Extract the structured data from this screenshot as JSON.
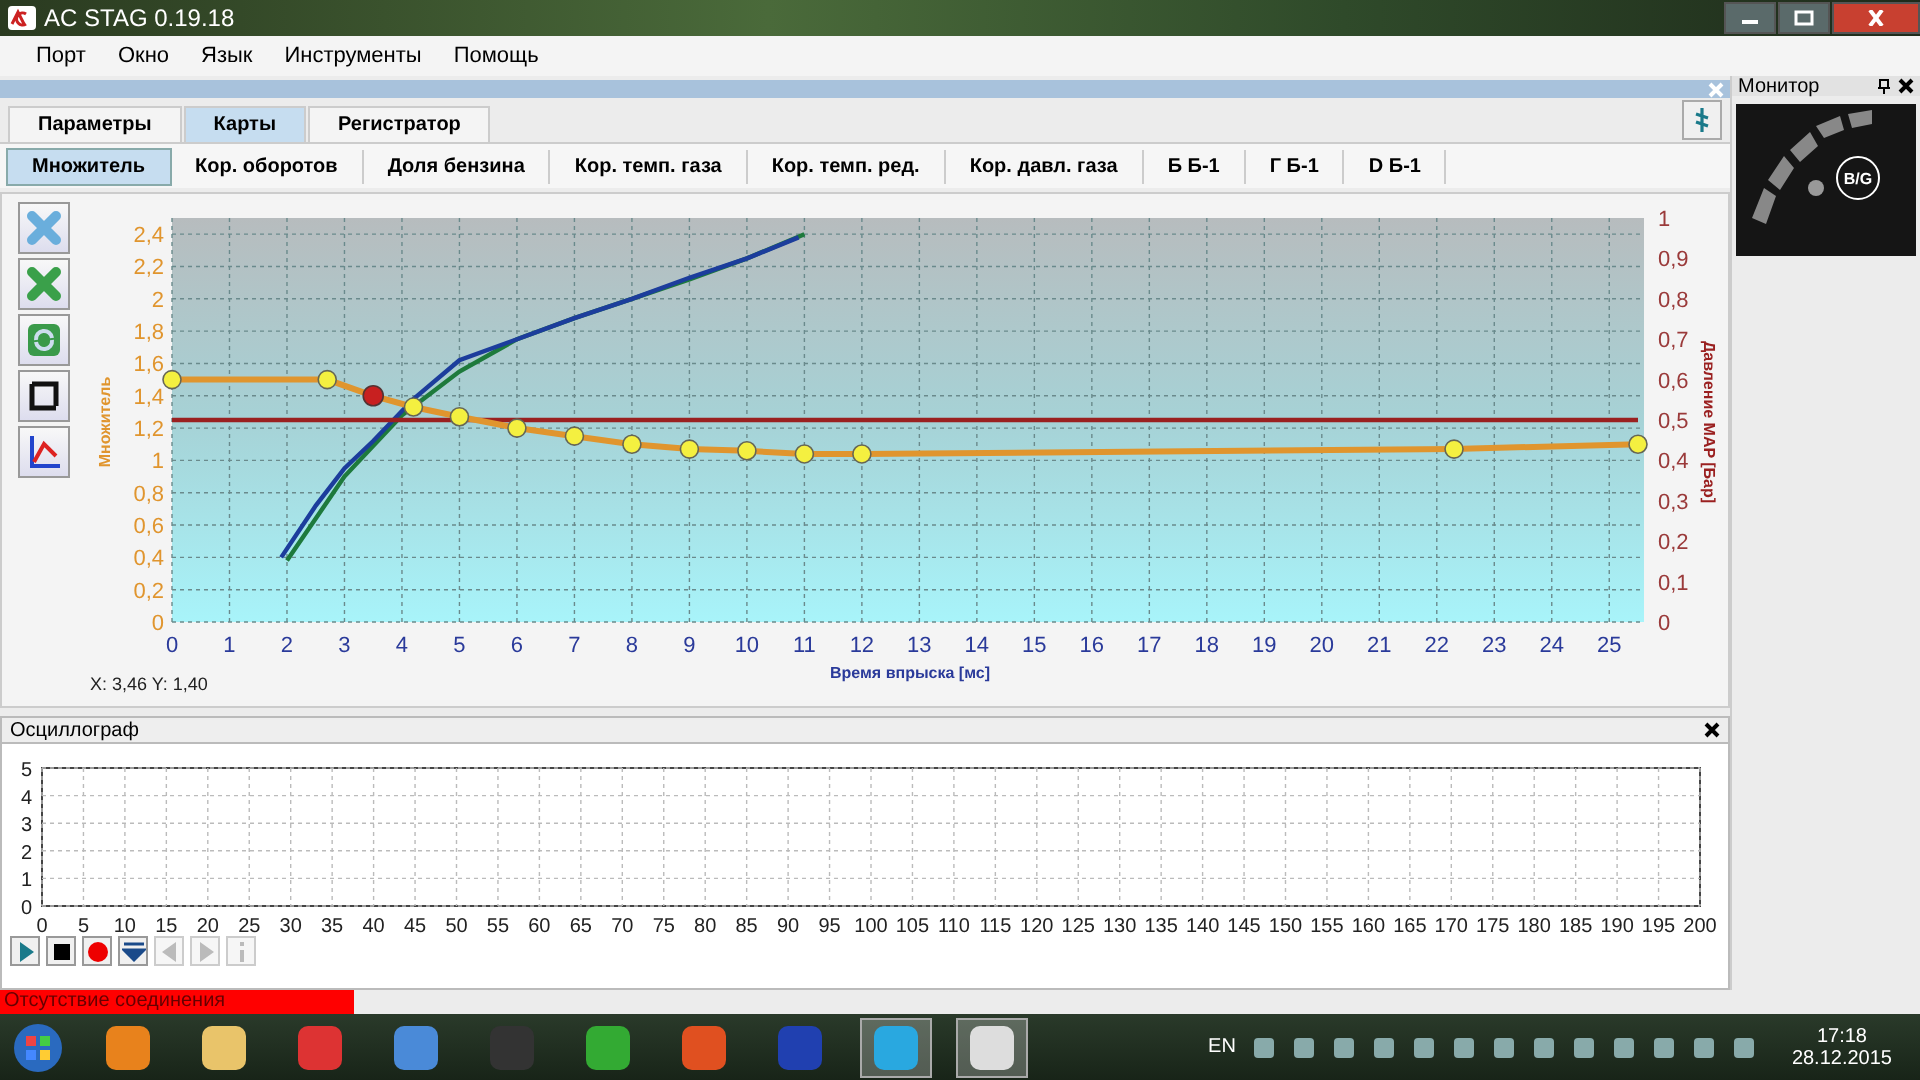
{
  "window": {
    "title": "AC STAG 0.19.18"
  },
  "menu": [
    "Порт",
    "Окно",
    "Язык",
    "Инструменты",
    "Помощь"
  ],
  "tabs": [
    {
      "label": "Параметры",
      "selected": false
    },
    {
      "label": "Карты",
      "selected": true
    },
    {
      "label": "Регистратор",
      "selected": false
    }
  ],
  "subtabs": [
    {
      "label": "Множитель",
      "selected": true
    },
    {
      "label": "Кор. оборотов",
      "selected": false
    },
    {
      "label": "Доля бензина",
      "selected": false
    },
    {
      "label": "Кор. темп. газа",
      "selected": false
    },
    {
      "label": "Кор. темп. ред.",
      "selected": false
    },
    {
      "label": "Кор. давл. газа",
      "selected": false
    },
    {
      "label": "Б Б-1",
      "selected": false
    },
    {
      "label": "Г Б-1",
      "selected": false
    },
    {
      "label": "D Б-1",
      "selected": false
    }
  ],
  "chart_tools": [
    {
      "kind": "clear-blue"
    },
    {
      "kind": "clear-green"
    },
    {
      "kind": "refresh"
    },
    {
      "kind": "frame"
    },
    {
      "kind": "curve"
    }
  ],
  "map_chart": {
    "chart_data": {
      "type": "line",
      "xlabel": "Время впрыска [мс]",
      "ylabel": "Множитель",
      "xlim": [
        0,
        25.5
      ],
      "ylim": [
        0,
        2.5
      ],
      "xticks": [
        0,
        1,
        2,
        3,
        4,
        5,
        6,
        7,
        8,
        9,
        10,
        11,
        12,
        13,
        14,
        15,
        16,
        17,
        18,
        19,
        20,
        21,
        22,
        23,
        24,
        25
      ],
      "yticks": [
        {
          "value": 0,
          "label": "0"
        },
        {
          "value": 0.2,
          "label": "0,2"
        },
        {
          "value": 0.4,
          "label": "0,4"
        },
        {
          "value": 0.6,
          "label": "0,6"
        },
        {
          "value": 0.8,
          "label": "0,8"
        },
        {
          "value": 1,
          "label": "1"
        },
        {
          "value": 1.2,
          "label": "1,2"
        },
        {
          "value": 1.4,
          "label": "1,4"
        },
        {
          "value": 1.6,
          "label": "1,6"
        },
        {
          "value": 1.8,
          "label": "1,8"
        },
        {
          "value": 2,
          "label": "2"
        },
        {
          "value": 2.2,
          "label": "2,2"
        },
        {
          "value": 2.4,
          "label": "2,4"
        }
      ],
      "grid": true,
      "series": [
        {
          "color": "#e0952e",
          "marker": "circle",
          "x": [
            0,
            2.7,
            3.5,
            4.2,
            5,
            6,
            7,
            8,
            9,
            10,
            11,
            12,
            22.3,
            25.5
          ],
          "values": [
            1.5,
            1.5,
            1.4,
            1.33,
            1.27,
            1.2,
            1.15,
            1.1,
            1.07,
            1.06,
            1.04,
            1.04,
            1.07,
            1.1
          ]
        },
        {
          "color": "#1e7a3c",
          "x": [
            2,
            3,
            4,
            5,
            6,
            7,
            8,
            9,
            10,
            11
          ],
          "values": [
            0.38,
            0.9,
            1.28,
            1.55,
            1.75,
            1.88,
            2.0,
            2.12,
            2.25,
            2.4
          ]
        },
        {
          "color": "#1c3d9c",
          "x": [
            1.9,
            2.5,
            3,
            3.5,
            4.2,
            5,
            6,
            7,
            8,
            9,
            10,
            10.9
          ],
          "values": [
            0.4,
            0.72,
            0.95,
            1.12,
            1.38,
            1.62,
            1.75,
            1.88,
            2.0,
            2.13,
            2.25,
            2.38
          ]
        },
        {
          "color": "#9a2020",
          "x": [
            0,
            25.5
          ],
          "values": [
            1.25,
            1.25
          ]
        }
      ]
    },
    "curve_points": [
      {
        "selected": false
      },
      {
        "selected": false
      },
      {
        "selected": true
      },
      {
        "selected": false
      },
      {
        "selected": false
      },
      {
        "selected": false
      },
      {
        "selected": false
      },
      {
        "selected": false
      },
      {
        "selected": false
      },
      {
        "selected": false
      },
      {
        "selected": false
      },
      {
        "selected": false
      },
      {
        "selected": false
      },
      {
        "selected": false
      }
    ],
    "right_axis": {
      "label": "Давление MAP [Бар]",
      "ticks": [
        "1",
        "0,9",
        "0,8",
        "0,7",
        "0,6",
        "0,5",
        "0,4",
        "0,3",
        "0,2",
        "0,1",
        "0"
      ]
    },
    "cursor": "X: 3,46  Y: 1,40"
  },
  "oscillograph": {
    "title": "Осциллограф",
    "chart_data": {
      "type": "line",
      "grid": true,
      "xlim": [
        0,
        200
      ],
      "ylim": [
        0,
        5
      ],
      "yticks": [
        0,
        1,
        2,
        3,
        4,
        5
      ],
      "xticks": [
        0,
        5,
        10,
        15,
        20,
        25,
        30,
        35,
        40,
        45,
        50,
        55,
        60,
        65,
        70,
        75,
        80,
        85,
        90,
        95,
        100,
        105,
        110,
        115,
        120,
        125,
        130,
        135,
        140,
        145,
        150,
        155,
        160,
        165,
        170,
        175,
        180,
        185,
        190,
        195,
        200
      ]
    },
    "controls": [
      {
        "kind": "play",
        "disabled": false
      },
      {
        "kind": "stop",
        "disabled": false
      },
      {
        "kind": "record",
        "disabled": false
      },
      {
        "kind": "down",
        "disabled": false
      },
      {
        "kind": "left",
        "disabled": true
      },
      {
        "kind": "right",
        "disabled": true
      },
      {
        "kind": "info",
        "disabled": true
      }
    ]
  },
  "monitor": {
    "title": "Монитор",
    "badge": "B/G"
  },
  "status_bar": {
    "connection": "Отсутствие соединения"
  },
  "taskbar": {
    "language": "EN",
    "time": "17:18",
    "date": "28.12.2015"
  }
}
